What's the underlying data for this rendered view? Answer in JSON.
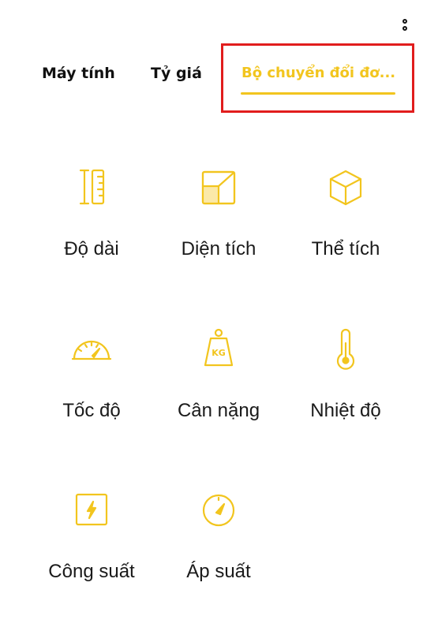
{
  "header": {
    "more_icon": "more-vertical-icon"
  },
  "tabs": [
    {
      "label": "Máy tính",
      "active": false
    },
    {
      "label": "Tỷ giá",
      "active": false
    },
    {
      "label": "Bộ chuyển đổi đơ...",
      "active": true
    }
  ],
  "colors": {
    "accent": "#f2c51e",
    "text": "#111111",
    "highlight": "#e11d1d"
  },
  "tiles": [
    {
      "label": "Độ dài",
      "icon": "ruler-icon"
    },
    {
      "label": "Diện tích",
      "icon": "area-icon"
    },
    {
      "label": "Thể tích",
      "icon": "cube-icon"
    },
    {
      "label": "Tốc độ",
      "icon": "speedometer-icon"
    },
    {
      "label": "Cân nặng",
      "icon": "weight-kg-icon"
    },
    {
      "label": "Nhiệt độ",
      "icon": "thermometer-icon"
    },
    {
      "label": "Công suất",
      "icon": "power-icon"
    },
    {
      "label": "Áp suất",
      "icon": "pressure-gauge-icon"
    }
  ]
}
